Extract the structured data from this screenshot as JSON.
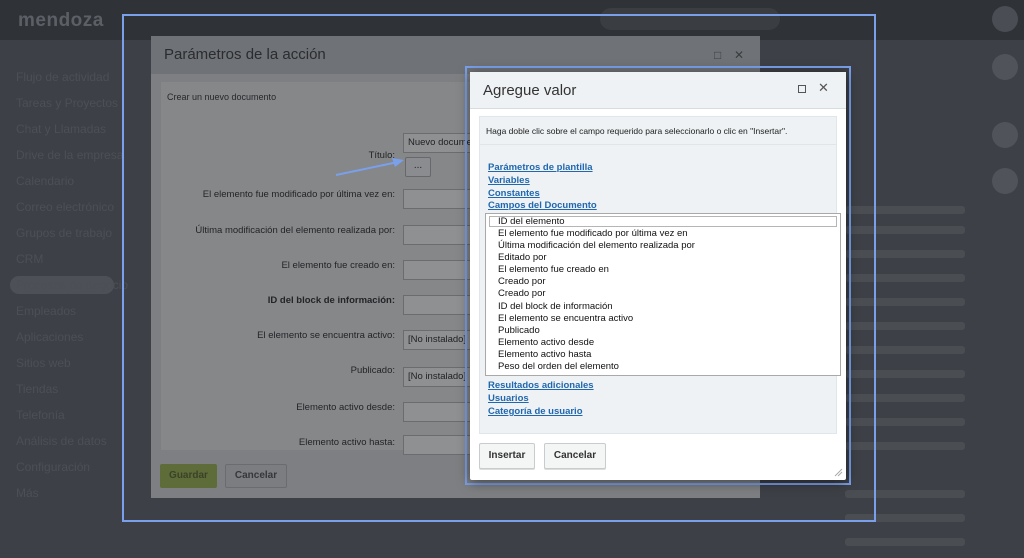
{
  "app": {
    "logo": "mendoza",
    "nav_items": [
      "Flujo de actividad",
      "Tareas y Proyectos",
      "Chat y Llamadas",
      "Drive de la empresa",
      "Calendario",
      "Correo electrónico",
      "Grupos de trabajo",
      "CRM",
      "Procesos de negocio",
      "Empleados",
      "Aplicaciones",
      "Sitios web",
      "Tiendas",
      "Telefonía",
      "Análisis de datos",
      "Configuración",
      "Más"
    ]
  },
  "params_dialog": {
    "title": "Parámetros de la acción",
    "subtitle": "Crear un nuevo documento",
    "rows": [
      {
        "label": "Título:",
        "value": "Nuevo documento"
      },
      {
        "label": "El elemento fue modificado por última vez en:",
        "value": ""
      },
      {
        "label": "Última modificación del elemento realizada por:",
        "value": ""
      },
      {
        "label": "El elemento fue creado en:",
        "value": ""
      },
      {
        "label": "ID del block de información:",
        "value": ""
      },
      {
        "label": "El elemento se encuentra activo:",
        "value": "[No instalado]"
      },
      {
        "label": "Publicado:",
        "value": "[No instalado]"
      },
      {
        "label": "Elemento activo desde:",
        "value": ""
      },
      {
        "label": "Elemento activo hasta:",
        "value": ""
      }
    ],
    "dots_label": "...",
    "save_label": "Guardar",
    "cancel_label": "Cancelar"
  },
  "value_dialog": {
    "title": "Agregue valor",
    "hint": "Haga doble clic sobre el campo requerido para seleccionarlo o clic en \"Insertar\".",
    "sections_top": [
      "Parámetros de plantilla",
      "Variables",
      "Constantes",
      "Campos del Documento"
    ],
    "fields": [
      "ID del elemento",
      "El elemento fue modificado por última vez en",
      "Última modificación del elemento realizada por",
      "Editado por",
      "El elemento fue creado en",
      "Creado por",
      "Creado por",
      "ID del block de información",
      "El elemento se encuentra activo",
      "Publicado",
      "Elemento activo desde",
      "Elemento activo hasta",
      "Peso del orden del elemento"
    ],
    "selected_field": "ID del elemento",
    "sections_bottom": [
      "Resultados adicionales",
      "Usuarios",
      "Categoría de usuario"
    ],
    "insert_label": "Insertar",
    "cancel_label": "Cancelar"
  },
  "colors": {
    "highlight_frame": "#7aa0ec",
    "link": "#2067b0",
    "dialog_header": "#eef2f4"
  }
}
